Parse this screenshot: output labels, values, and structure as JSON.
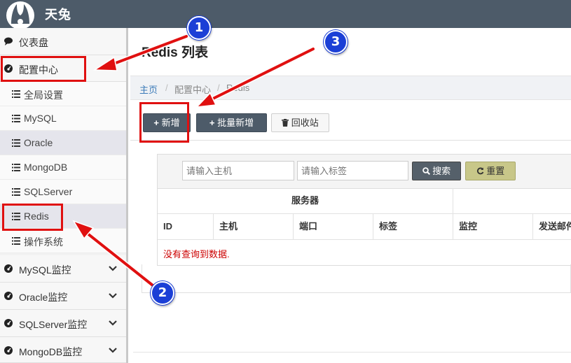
{
  "app": {
    "brand": "天兔"
  },
  "sidebar": {
    "dashboard": "仪表盘",
    "config_center": "配置中心",
    "config_items": [
      "全局设置",
      "MySQL",
      "Oracle",
      "MongoDB",
      "SQLServer",
      "Redis",
      "操作系统"
    ],
    "active_sub": "Redis",
    "monitors": [
      "MySQL监控",
      "Oracle监控",
      "SQLServer监控",
      "MongoDB监控"
    ]
  },
  "main": {
    "title": "Redis 列表",
    "breadcrumb": [
      "主页",
      "配置中心",
      "Redis"
    ],
    "toolbar": {
      "add": "新增",
      "batch_add": "批量新增",
      "recycle": "回收站"
    },
    "search": {
      "host_placeholder": "请输入主机",
      "tag_placeholder": "请输入标签",
      "search_label": "搜索",
      "reset_label": "重置"
    },
    "table": {
      "group_header": "服务器",
      "columns": [
        "ID",
        "主机",
        "端口",
        "标签",
        "监控",
        "发送邮件"
      ],
      "empty_text": "没有查询到数据."
    }
  },
  "annotations": [
    "1",
    "2",
    "3"
  ],
  "colors": {
    "topbar": "#4d5b69",
    "annotation_red": "#e01010",
    "badge_blue": "#1b3fd6"
  }
}
